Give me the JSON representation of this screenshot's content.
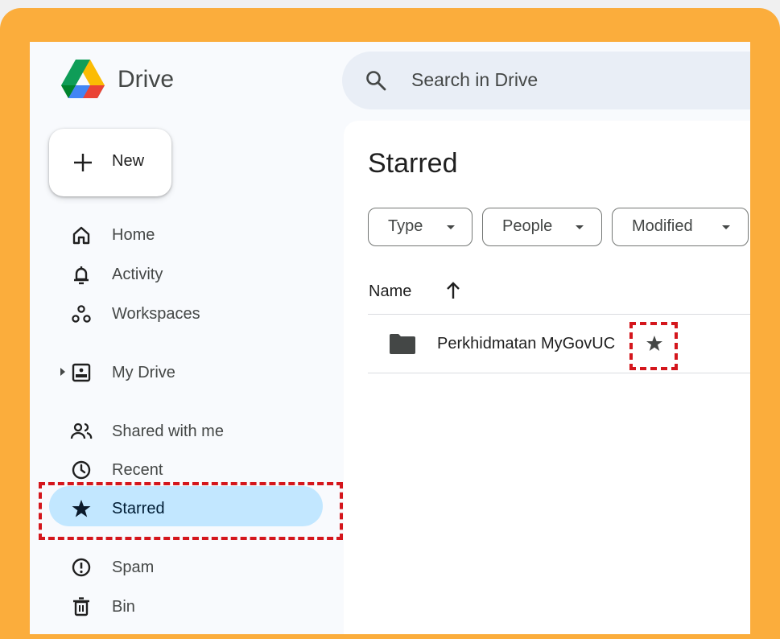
{
  "header": {
    "brand": "Drive",
    "search_placeholder": "Search in Drive"
  },
  "new_button": {
    "label": "New"
  },
  "sidebar": {
    "items": [
      {
        "label": "Home",
        "icon": "home-icon"
      },
      {
        "label": "Activity",
        "icon": "bell-icon"
      },
      {
        "label": "Workspaces",
        "icon": "workspaces-icon"
      },
      {
        "label": "My Drive",
        "icon": "my-drive-icon"
      },
      {
        "label": "Shared with me",
        "icon": "people-icon"
      },
      {
        "label": "Recent",
        "icon": "clock-icon"
      },
      {
        "label": "Starred",
        "icon": "star-icon",
        "active": true
      },
      {
        "label": "Spam",
        "icon": "spam-icon"
      },
      {
        "label": "Bin",
        "icon": "trash-icon"
      }
    ]
  },
  "main": {
    "title": "Starred",
    "filters": [
      "Type",
      "People",
      "Modified"
    ],
    "columns": {
      "name": "Name"
    },
    "files": [
      {
        "name": "Perkhidmatan MyGovUC",
        "type": "folder",
        "starred": true
      }
    ]
  },
  "colors": {
    "frame": "#fbad3c",
    "active_pill": "#c2e7ff",
    "highlight": "#d4161c",
    "search_bg": "#e9eef6"
  }
}
